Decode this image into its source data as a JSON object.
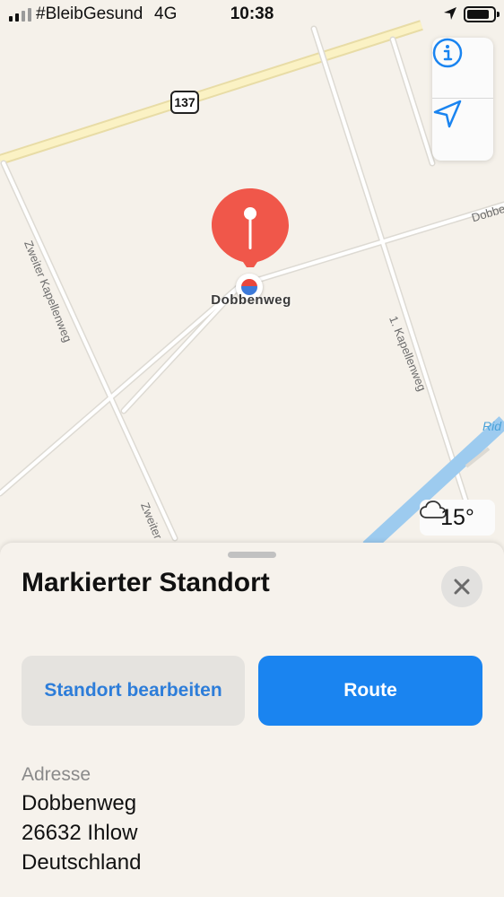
{
  "status_bar": {
    "carrier": "#BleibGesund",
    "network": "4G",
    "time": "10:38"
  },
  "map": {
    "road_shield": "137",
    "street_labels": [
      "Zweiter Kapellenweg",
      "Zweiter",
      "1. Kapellenweg",
      "Dobbe"
    ],
    "water_label": "Rid",
    "pin_label": "Dobbenweg",
    "pin_color": "#f0574a",
    "weather": {
      "icon": "cloud-icon",
      "temperature": "15°"
    },
    "controls": {
      "info_icon": "info-icon",
      "location_icon": "location-arrow-icon",
      "accent": "#1a84f0"
    }
  },
  "sheet": {
    "title": "Markierter Standort",
    "edit_button": "Standort bearbeiten",
    "route_button": "Route",
    "address_heading": "Adresse",
    "address_lines": [
      "Dobbenweg",
      "26632 Ihlow",
      "Deutschland"
    ]
  }
}
